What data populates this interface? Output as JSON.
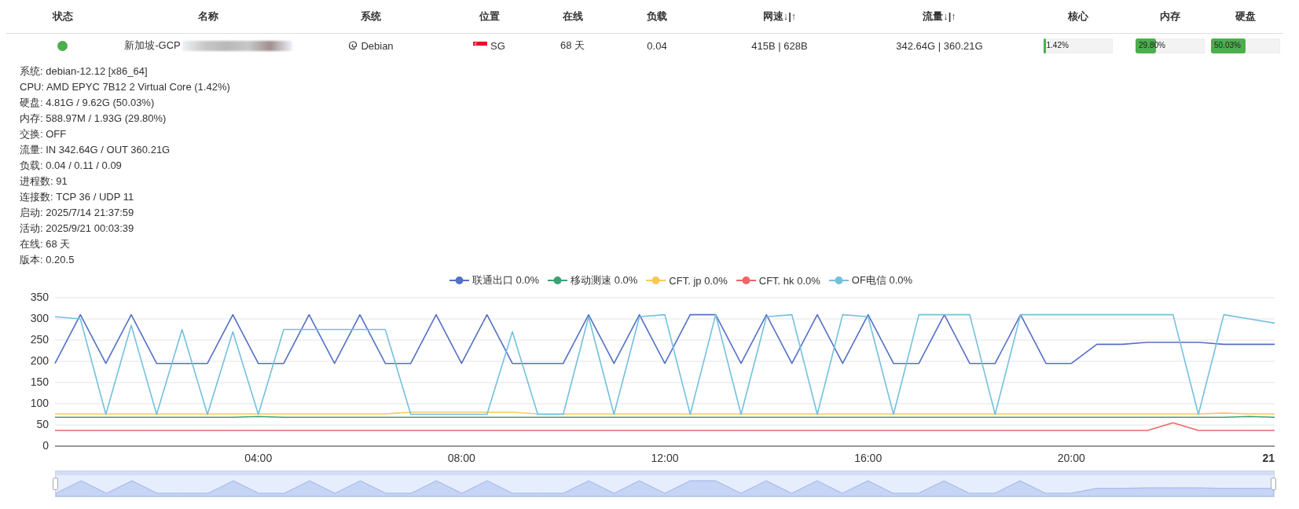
{
  "table": {
    "columns": [
      "状态",
      "名称",
      "系统",
      "位置",
      "在线",
      "负载",
      "网速↓|↑",
      "流量↓|↑",
      "核心",
      "内存",
      "硬盘"
    ],
    "rows": [
      {
        "online": true,
        "name": "新加坡-GCP",
        "os": "Debian",
        "region": "SG",
        "uptime": "68 天",
        "load": "0.04",
        "speed": "415B | 628B",
        "traffic": "342.64G | 360.21G",
        "meters": [
          {
            "level": 0.0142,
            "reading": "1.42%"
          },
          {
            "level": 0.298,
            "reading": "29.80%"
          },
          {
            "level": 0.5003,
            "reading": "50.03%"
          }
        ]
      }
    ]
  },
  "details": [
    "系统: debian-12.12 [x86_64]",
    "CPU: AMD EPYC 7B12 2 Virtual Core (1.42%)",
    "硬盘: 4.81G / 9.62G (50.03%)",
    "内存: 588.97M / 1.93G (29.80%)",
    "交换: OFF",
    "流量: IN 342.64G / OUT 360.21G",
    "负载: 0.04 / 0.11 / 0.09",
    "进程数: 91",
    "连接数: TCP 36 / UDP 11",
    "启动: 2025/7/14 21:37:59",
    "活动: 2025/9/21 00:03:39",
    "在线: 68 天",
    "版本: 0.20.5"
  ],
  "latency_chart": {
    "legend_suffixes": [
      "0.0%",
      "0.0%",
      "0.0%",
      "0.0%",
      "0.0%"
    ],
    "data_zoom": {
      "level": 1
    },
    "chart_data": {
      "type": "line",
      "grid": true,
      "xlim": [
        "2025-09-20 00:00",
        "2025-09-21 00:00"
      ],
      "ylim": [
        0,
        350
      ],
      "yticks": [
        0,
        50,
        100,
        150,
        200,
        250,
        300,
        350
      ],
      "xticks": [
        {
          "value": "2025-09-20 04:00",
          "label": "04:00"
        },
        {
          "value": "2025-09-20 08:00",
          "label": "08:00"
        },
        {
          "value": "2025-09-20 12:00",
          "label": "12:00"
        },
        {
          "value": "2025-09-20 16:00",
          "label": "16:00"
        },
        {
          "value": "2025-09-20 20:00",
          "label": "20:00"
        },
        {
          "value": "2025-09-21 00:00",
          "label": "21"
        }
      ],
      "x": [
        "2025-09-20 00:00",
        "2025-09-20 00:30",
        "2025-09-20 01:00",
        "2025-09-20 01:30",
        "2025-09-20 02:00",
        "2025-09-20 02:30",
        "2025-09-20 03:00",
        "2025-09-20 03:30",
        "2025-09-20 04:00",
        "2025-09-20 04:30",
        "2025-09-20 05:00",
        "2025-09-20 05:30",
        "2025-09-20 06:00",
        "2025-09-20 06:30",
        "2025-09-20 07:00",
        "2025-09-20 07:30",
        "2025-09-20 08:00",
        "2025-09-20 08:30",
        "2025-09-20 09:00",
        "2025-09-20 09:30",
        "2025-09-20 10:00",
        "2025-09-20 10:30",
        "2025-09-20 11:00",
        "2025-09-20 11:30",
        "2025-09-20 12:00",
        "2025-09-20 12:30",
        "2025-09-20 13:00",
        "2025-09-20 13:30",
        "2025-09-20 14:00",
        "2025-09-20 14:30",
        "2025-09-20 15:00",
        "2025-09-20 15:30",
        "2025-09-20 16:00",
        "2025-09-20 16:30",
        "2025-09-20 17:00",
        "2025-09-20 17:30",
        "2025-09-20 18:00",
        "2025-09-20 18:30",
        "2025-09-20 19:00",
        "2025-09-20 19:30",
        "2025-09-20 20:00",
        "2025-09-20 20:30",
        "2025-09-20 21:00",
        "2025-09-20 21:30",
        "2025-09-20 22:00",
        "2025-09-20 22:30",
        "2025-09-20 23:00",
        "2025-09-20 23:30",
        "2025-09-21 00:00"
      ],
      "series": [
        {
          "name": "联通出口",
          "color": "#5470c6",
          "values": [
            195,
            310,
            195,
            310,
            195,
            195,
            195,
            310,
            195,
            195,
            310,
            195,
            310,
            195,
            195,
            310,
            195,
            310,
            195,
            195,
            195,
            310,
            195,
            310,
            195,
            310,
            310,
            195,
            310,
            195,
            310,
            195,
            310,
            195,
            195,
            310,
            195,
            195,
            310,
            195,
            195,
            240,
            240,
            245,
            245,
            245,
            240,
            240,
            240
          ]
        },
        {
          "name": "移动测速",
          "color": "#3ba272",
          "values": [
            68,
            68,
            68,
            68,
            68,
            68,
            68,
            68,
            70,
            68,
            68,
            68,
            68,
            68,
            68,
            68,
            68,
            68,
            68,
            68,
            68,
            68,
            68,
            68,
            68,
            68,
            68,
            68,
            68,
            68,
            68,
            68,
            68,
            68,
            68,
            68,
            68,
            68,
            68,
            68,
            68,
            68,
            68,
            68,
            68,
            68,
            68,
            70,
            68
          ]
        },
        {
          "name": "CFT. jp",
          "color": "#fac858",
          "values": [
            76,
            76,
            76,
            76,
            76,
            76,
            76,
            76,
            76,
            76,
            76,
            76,
            76,
            76,
            80,
            80,
            80,
            80,
            80,
            76,
            76,
            76,
            76,
            76,
            76,
            76,
            76,
            76,
            76,
            76,
            76,
            76,
            76,
            76,
            76,
            76,
            76,
            76,
            76,
            76,
            76,
            76,
            76,
            76,
            76,
            76,
            78,
            76,
            76
          ]
        },
        {
          "name": "CFT. hk",
          "color": "#ee6666",
          "values": [
            37,
            37,
            37,
            37,
            37,
            37,
            37,
            37,
            37,
            37,
            37,
            37,
            37,
            37,
            37,
            37,
            37,
            37,
            37,
            37,
            37,
            37,
            37,
            37,
            37,
            37,
            37,
            37,
            37,
            37,
            37,
            37,
            37,
            37,
            37,
            37,
            37,
            37,
            37,
            37,
            37,
            37,
            37,
            37,
            55,
            37,
            37,
            37,
            37
          ]
        },
        {
          "name": "OF电信",
          "color": "#73c0de",
          "values": [
            305,
            300,
            75,
            285,
            75,
            275,
            75,
            270,
            75,
            275,
            275,
            275,
            275,
            275,
            75,
            75,
            75,
            75,
            270,
            75,
            75,
            305,
            75,
            305,
            310,
            75,
            310,
            75,
            305,
            310,
            75,
            310,
            305,
            75,
            310,
            310,
            310,
            75,
            310,
            310,
            310,
            310,
            310,
            310,
            310,
            75,
            310,
            300,
            290
          ]
        }
      ]
    }
  }
}
